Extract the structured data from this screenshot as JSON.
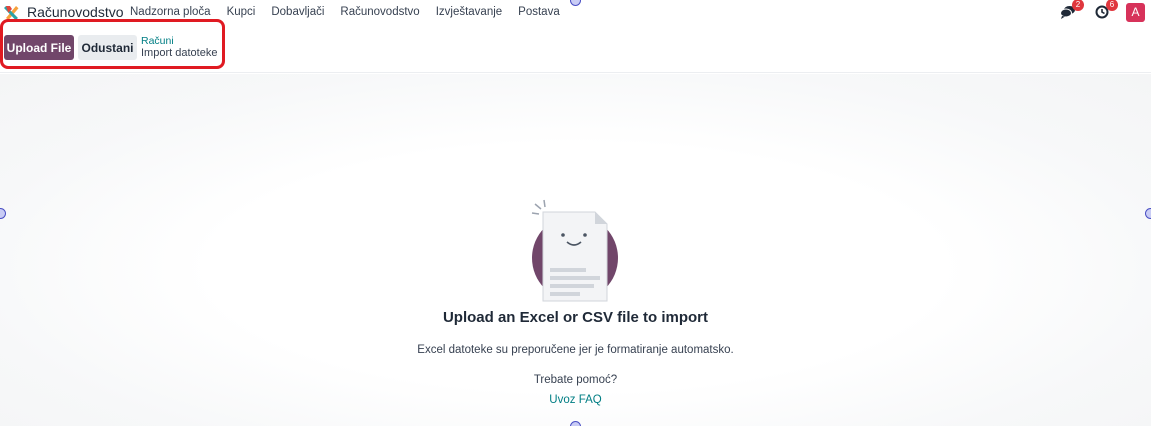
{
  "navbar": {
    "app_name": "Računovodstvo",
    "menu": [
      "Nadzorna ploča",
      "Kupci",
      "Dobavljači",
      "Računovodstvo",
      "Izvještavanje",
      "Postava"
    ],
    "chat_count": "2",
    "activity_count": "6",
    "avatar_letter": "A"
  },
  "control_panel": {
    "upload_label": "Upload File",
    "cancel_label": "Odustani",
    "breadcrumb_parent": "Računi",
    "breadcrumb_current": "Import datoteke"
  },
  "empty_state": {
    "title": "Upload an Excel or CSV file to import",
    "description": "Excel datoteke su preporučene jer je formatiranje automatsko.",
    "help_text": "Trebate pomoć?",
    "help_link": "Uvoz FAQ"
  },
  "colors": {
    "primary": "#71466a",
    "link": "#017e84",
    "highlight": "#e01a22",
    "badge": "#e0373e",
    "avatar": "#d7325a"
  }
}
